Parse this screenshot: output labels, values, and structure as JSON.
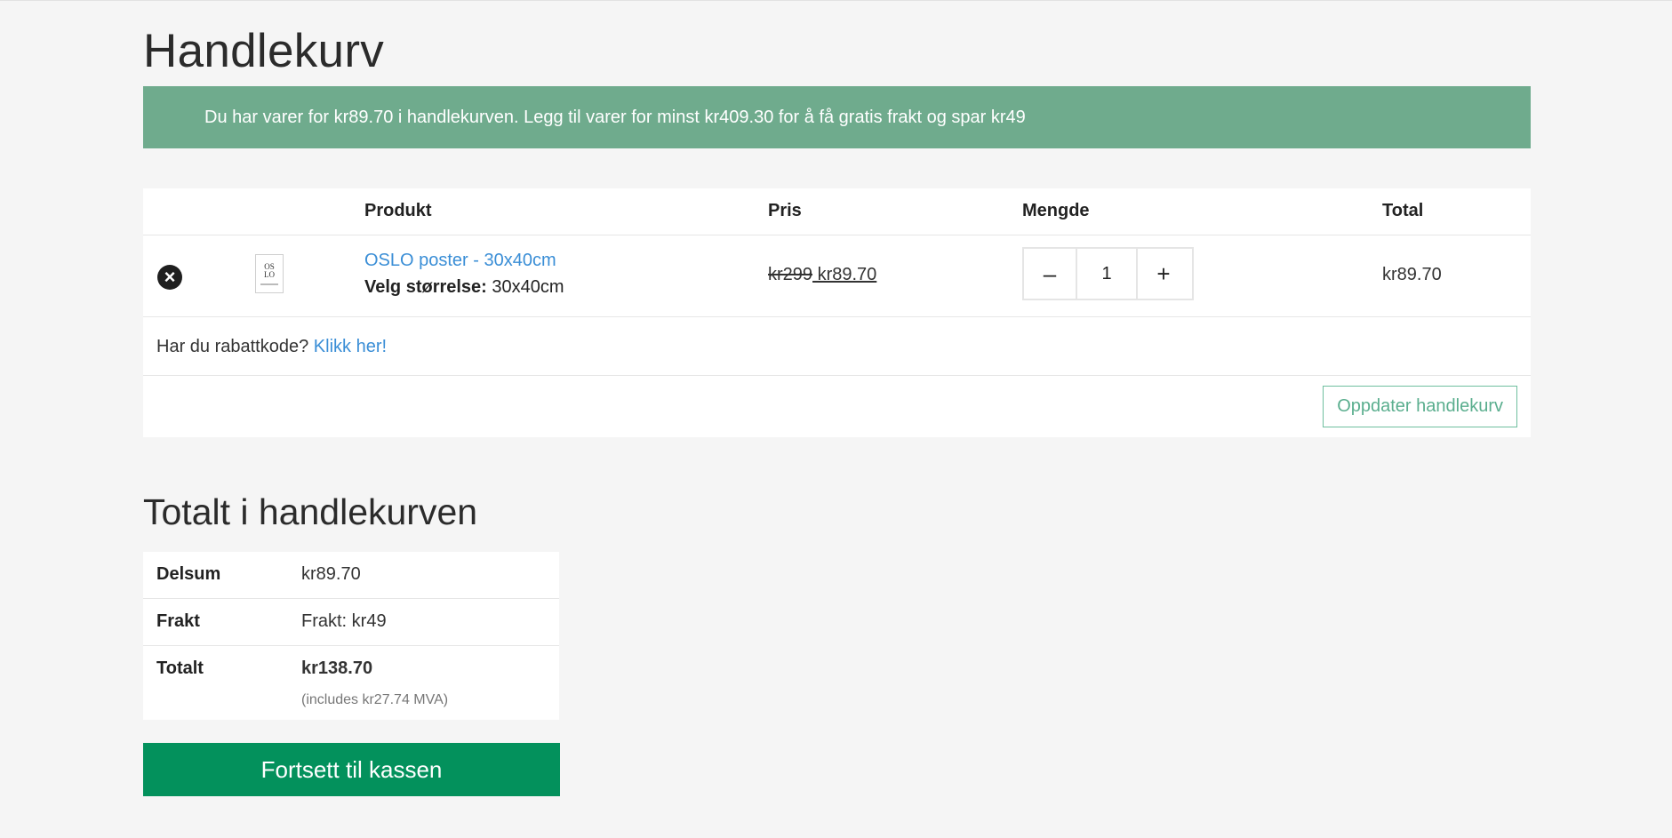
{
  "page": {
    "title": "Handlekurv"
  },
  "notice": {
    "text": "Du har varer for kr89.70 i handlekurven. Legg til varer for minst kr409.30 for å få gratis frakt og spar kr49"
  },
  "cart": {
    "headers": {
      "product": "Produkt",
      "price": "Pris",
      "quantity": "Mengde",
      "total": "Total"
    },
    "items": [
      {
        "remove_icon": "×",
        "thumb_text_line1": "OS",
        "thumb_text_line2": "LO",
        "name": "OSLO poster - 30x40cm",
        "variant_label": "Velg størrelse:",
        "variant_value": "30x40cm",
        "price_old": "kr299",
        "price_new": " kr89.70",
        "qty_minus": "–",
        "qty": "1",
        "qty_plus": "+",
        "line_total": "kr89.70"
      }
    ],
    "coupon_text": "Har du rabattkode?",
    "coupon_link": "Klikk her!",
    "update_button": "Oppdater handlekurv"
  },
  "totals": {
    "title": "Totalt i handlekurven",
    "subtotal_label": "Delsum",
    "subtotal_value": "kr89.70",
    "shipping_label": "Frakt",
    "shipping_value": "Frakt: kr49",
    "total_label": "Totalt",
    "total_value": "kr138.70",
    "tax_note": "(includes kr27.74 MVA)"
  },
  "checkout_button": "Fortsett til kassen",
  "colors": {
    "notice_bg": "#6fab8d",
    "link": "#3a8ed6",
    "checkout_bg": "#03915c",
    "update_border": "#6fbf9f"
  },
  "icons": {
    "remove": "remove-circle-icon"
  }
}
